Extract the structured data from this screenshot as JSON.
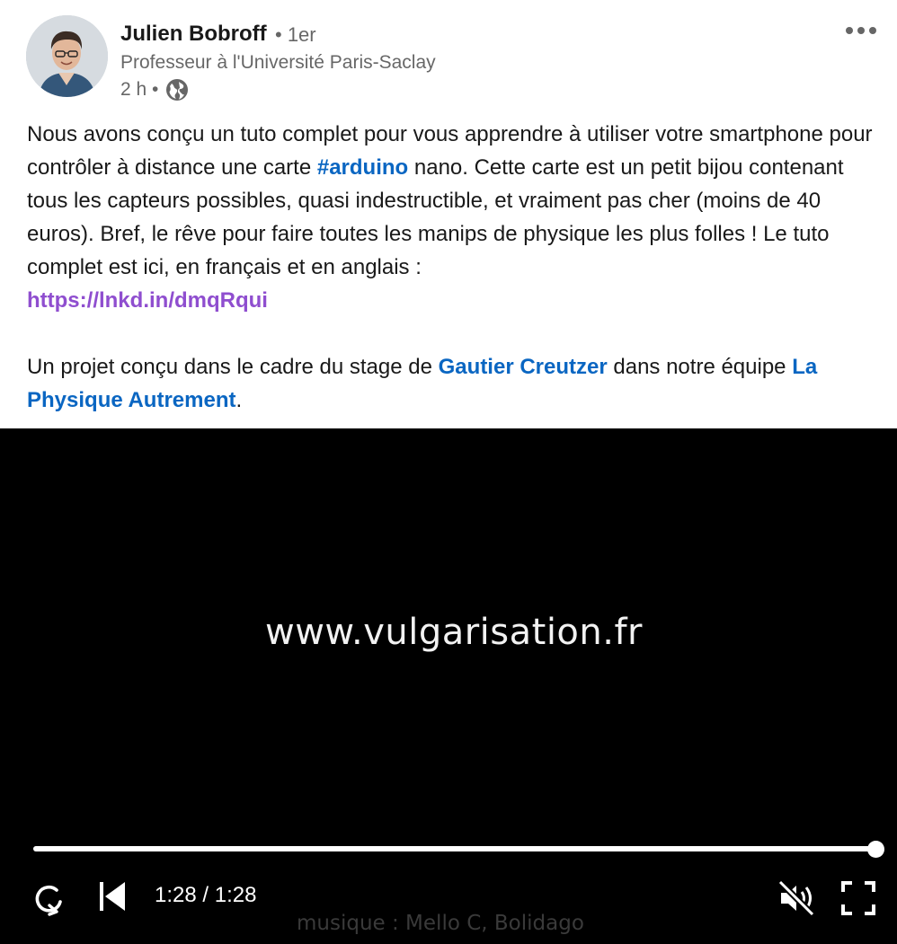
{
  "author": {
    "name": "Julien Bobroff",
    "degree": "• 1er",
    "title": "Professeur à l'Université Paris-Saclay",
    "time": "2 h •",
    "visibility_icon": "globe-icon"
  },
  "menu": {
    "icon": "more-horizontal-icon"
  },
  "commentary": {
    "p1_t1": "Nous avons conçu un tuto complet pour vous apprendre à utiliser votre smartphone pour contrôler à distance une carte ",
    "hashtag": "#arduino",
    "p1_t2": " nano. Cette carte est un petit bijou contenant tous les capteurs possibles, quasi indestructible, et vraiment pas cher (moins de 40 euros). Bref, le rêve pour faire toutes les manips de physique les plus folles ! Le tuto complet est ici, en français et en anglais :",
    "link": "https://lnkd.in/dmqRqui",
    "p2_t1": "Un projet conçu dans le cadre du stage de ",
    "mention1": "Gautier Creutzer",
    "p2_t2": " dans notre équipe ",
    "mention2": "La Physique Autrement",
    "p2_t3": "."
  },
  "video": {
    "caption": "www.vulgarisation.fr",
    "time_display": "1:28 / 1:28",
    "progress": 1.0,
    "credit": "musique : Mello C, Bolidago",
    "controls": {
      "replay_icon": "replay-icon",
      "previous_icon": "skip-previous-icon",
      "mute_icon": "volume-muted-icon",
      "fullscreen_icon": "fullscreen-icon"
    }
  },
  "colors": {
    "link_blue": "#0a66c2",
    "visited_purple": "#8f4ecf",
    "video_bg": "#000000"
  }
}
